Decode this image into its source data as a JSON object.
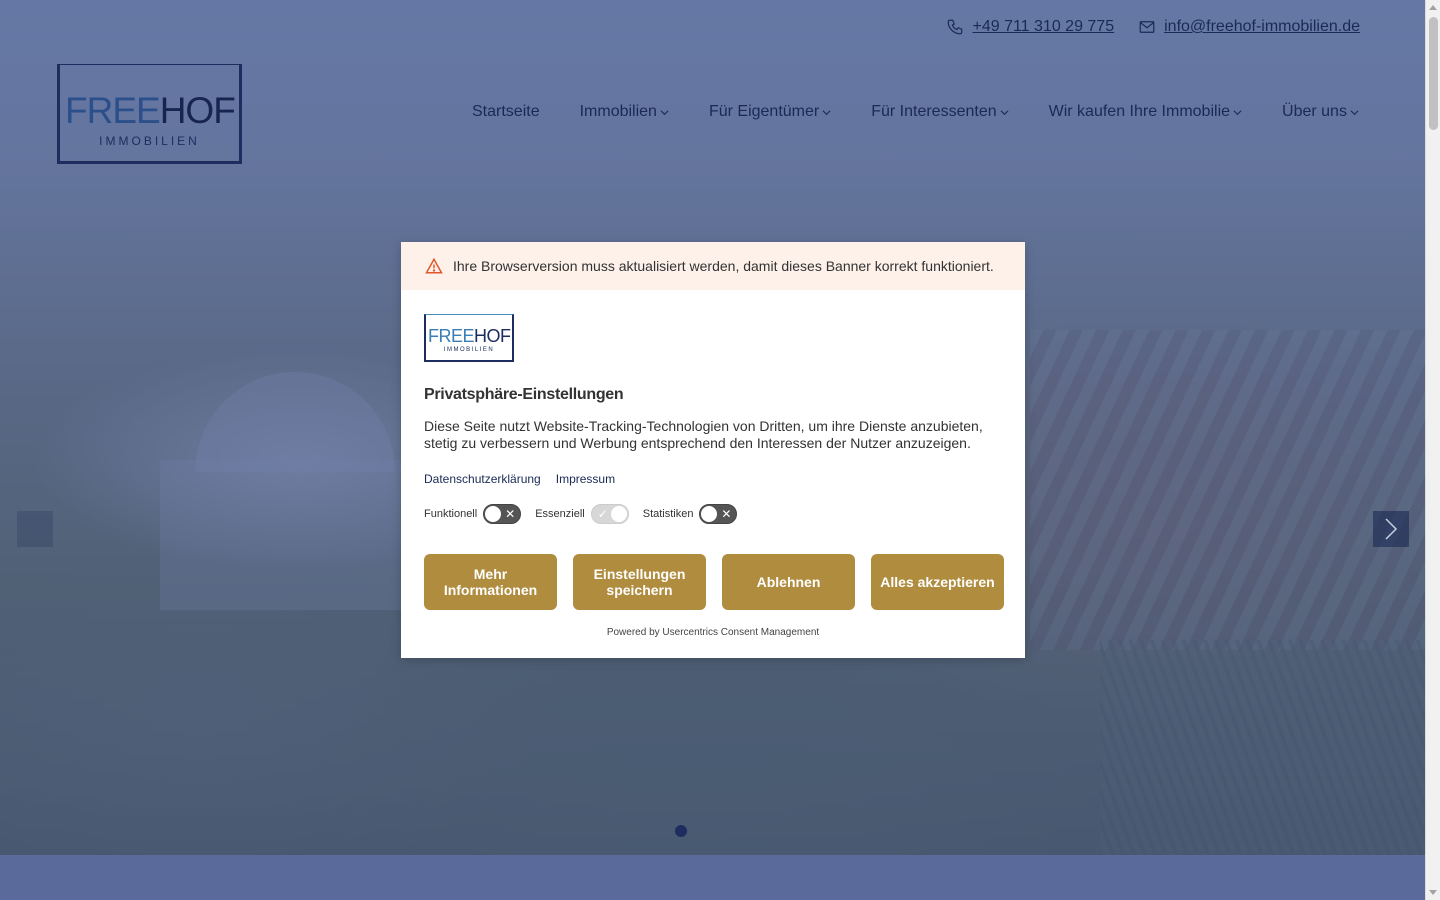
{
  "header": {
    "phone": "+49 711 310 29 775",
    "email": "info@freehof-immobilien.de",
    "logo": {
      "word_a": "FREE",
      "word_b": "HOF",
      "sub": "IMMOBILIEN"
    }
  },
  "nav": {
    "items": [
      {
        "label": "Startseite",
        "has_dropdown": false
      },
      {
        "label": "Immobilien",
        "has_dropdown": true
      },
      {
        "label": "Für Eigentümer",
        "has_dropdown": true
      },
      {
        "label": "Für Interessenten",
        "has_dropdown": true
      },
      {
        "label": "Wir kaufen Ihre Immobilie",
        "has_dropdown": true
      },
      {
        "label": "Über uns",
        "has_dropdown": true
      }
    ]
  },
  "consent": {
    "warning": "Ihre Browserversion muss aktualisiert werden, damit dieses Banner korrekt funktioniert.",
    "logo": {
      "word_a": "FREE",
      "word_b": "HOF",
      "sub": "IMMOBILIEN"
    },
    "title": "Privatsphäre-Einstellungen",
    "description": "Diese Seite nutzt Website-Tracking-Technologien von Dritten, um ihre Dienste anzubieten, stetig zu verbessern und Werbung entsprechend den Interessen der Nutzer anzuzeigen.",
    "links": {
      "privacy": "Datenschutzerklärung",
      "imprint": "Impressum"
    },
    "toggles": [
      {
        "label": "Funktionell",
        "state": "off"
      },
      {
        "label": "Essenziell",
        "state": "on"
      },
      {
        "label": "Statistiken",
        "state": "off"
      }
    ],
    "buttons": {
      "more": "Mehr Informationen",
      "save": "Einstellungen speichern",
      "decline": "Ablehnen",
      "accept": "Alles akzeptieren"
    },
    "powered": "Powered by Usercentrics Consent Management"
  },
  "colors": {
    "accent_button": "#b08c3e",
    "navy": "#1d2d60",
    "overlay": "#28418a"
  }
}
